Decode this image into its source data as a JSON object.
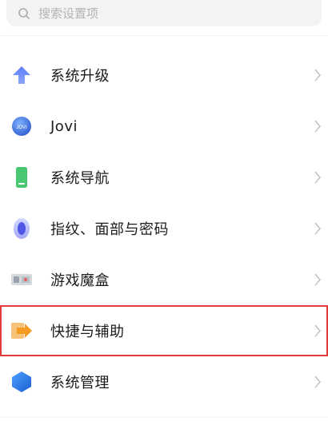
{
  "search": {
    "placeholder": "搜索设置项",
    "icon": "search-icon"
  },
  "settings_items": [
    {
      "label": "系统升级",
      "icon": "upgrade-arrow-icon",
      "accent": "#4f7df1"
    },
    {
      "label": "Jovi",
      "icon": "jovi-icon",
      "accent": "#3b6fd8"
    },
    {
      "label": "系统导航",
      "icon": "phone-navigation-icon",
      "accent": "#45c26e"
    },
    {
      "label": "指纹、面部与密码",
      "icon": "fingerprint-icon",
      "accent": "#6b6cf0"
    },
    {
      "label": "游戏魔盒",
      "icon": "game-box-icon",
      "accent": "#9aa3ad"
    },
    {
      "label": "快捷与辅助",
      "icon": "shortcut-arrow-icon",
      "accent": "#f59a23",
      "highlighted": true
    },
    {
      "label": "系统管理",
      "icon": "system-hexagon-icon",
      "accent": "#1f7ae0"
    }
  ],
  "colors": {
    "highlight_border": "#e03a3a",
    "chevron": "#c4c4c4"
  }
}
